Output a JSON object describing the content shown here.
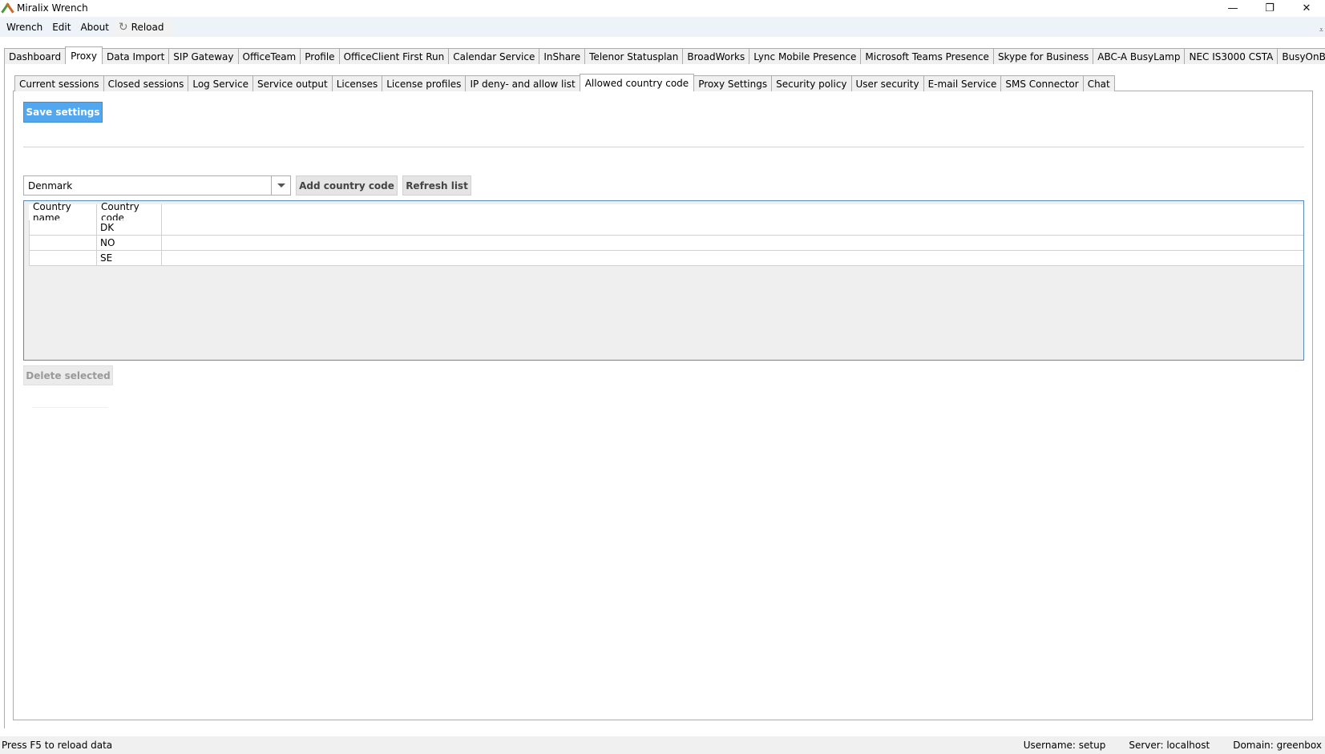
{
  "window": {
    "title": "Miralix Wrench",
    "minimize": "—",
    "restore": "❐",
    "close": "✕"
  },
  "menu": {
    "items": [
      "Wrench",
      "Edit",
      "About"
    ],
    "reload_label": "Reload",
    "reload_icon": "↻"
  },
  "top_tabs": {
    "items": [
      "Dashboard",
      "Proxy",
      "Data Import",
      "SIP Gateway",
      "OfficeTeam",
      "Profile",
      "OfficeClient First Run",
      "Calendar Service",
      "InShare",
      "Telenor Statusplan",
      "BroadWorks",
      "Lync Mobile Presence",
      "Microsoft Teams Presence",
      "Skype for Business",
      "ABC-A BusyLamp",
      "NEC IS3000 CSTA",
      "BusyOnBusy"
    ],
    "active": "Proxy"
  },
  "sub_tabs": {
    "items": [
      "Current sessions",
      "Closed sessions",
      "Log Service",
      "Service output",
      "Licenses",
      "License profiles",
      "IP deny- and allow list",
      "Allowed country code",
      "Proxy Settings",
      "Security policy",
      "User security",
      "E-mail Service",
      "SMS Connector",
      "Chat"
    ],
    "active": "Allowed country code"
  },
  "content": {
    "save_label": "Save settings",
    "country_select_value": "Denmark",
    "add_label": "Add country code",
    "refresh_label": "Refresh list",
    "delete_label": "Delete selected"
  },
  "table": {
    "columns": [
      "Country name",
      "Country code"
    ],
    "rows": [
      {
        "name": "",
        "code": "DK"
      },
      {
        "name": "",
        "code": "NO"
      },
      {
        "name": "",
        "code": "SE"
      }
    ]
  },
  "status": {
    "hint": "Press F5 to reload data",
    "username": "Username: setup",
    "server": "Server: localhost",
    "domain": "Domain: greenbox"
  },
  "colors": {
    "accent": "#52a7ef",
    "menubar_bg": "#eef3fa",
    "grid_border": "#5b8ab8"
  }
}
